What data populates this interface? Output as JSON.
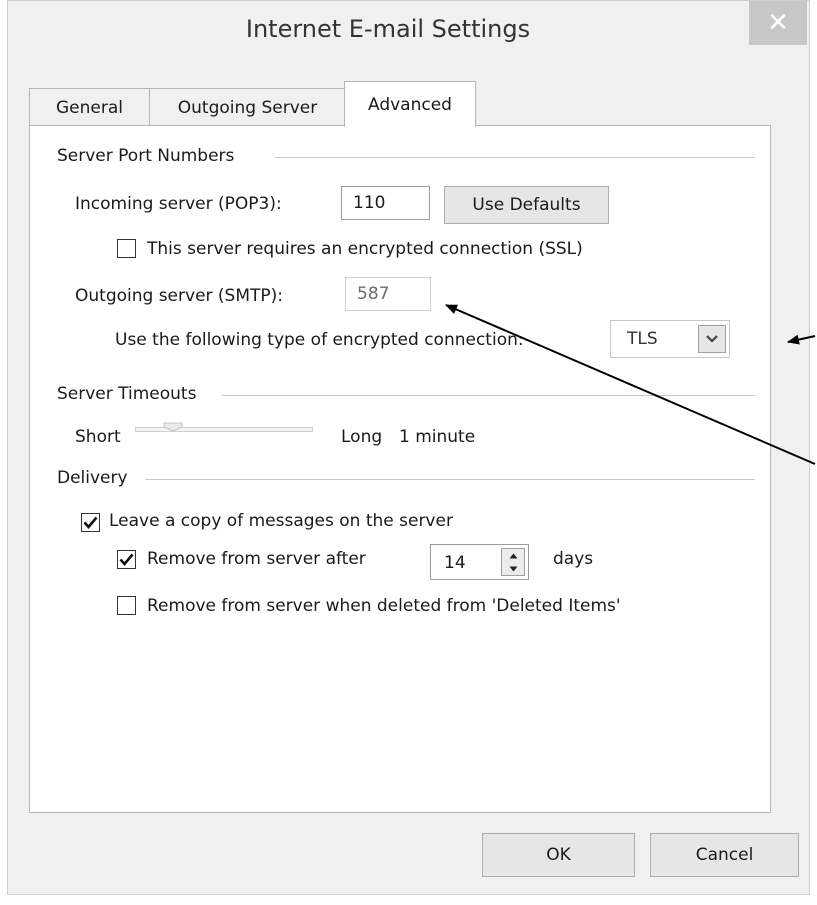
{
  "window": {
    "title": "Internet E-mail Settings",
    "close_symbol": "✕"
  },
  "tabs": [
    {
      "label": "General",
      "active": false
    },
    {
      "label": "Outgoing Server",
      "active": false
    },
    {
      "label": "Advanced",
      "active": true
    }
  ],
  "server_ports": {
    "group_title": "Server Port Numbers",
    "incoming_label": "Incoming server (POP3):",
    "incoming_value": "110",
    "use_defaults_label": "Use Defaults",
    "ssl_label": "This server requires an encrypted connection (SSL)",
    "ssl_checked": false,
    "outgoing_label": "Outgoing server (SMTP):",
    "outgoing_value": "587",
    "encryption_label": "Use the following type of encrypted connection:",
    "encryption_value": "TLS"
  },
  "timeouts": {
    "group_title": "Server Timeouts",
    "short_label": "Short",
    "long_label": "Long",
    "value_text": "1 minute"
  },
  "delivery": {
    "group_title": "Delivery",
    "leave_copy_label": "Leave a copy of messages on the server",
    "leave_copy_checked": true,
    "remove_after_label": "Remove from server after",
    "remove_after_checked": true,
    "remove_after_days": "14",
    "days_label": "days",
    "remove_deleted_label": "Remove from server when deleted from 'Deleted Items'",
    "remove_deleted_checked": false
  },
  "footer": {
    "ok_label": "OK",
    "cancel_label": "Cancel"
  },
  "colors": {
    "dialog_background": "#f0f0f0",
    "close_button": "#c7c7c7",
    "annotation_arrow": "#000000"
  },
  "icons": {
    "close": "close-icon",
    "dropdown": "chevron-down-icon",
    "check": "checkmark-icon",
    "spin_up": "spin-up-icon",
    "spin_down": "spin-down-icon"
  }
}
